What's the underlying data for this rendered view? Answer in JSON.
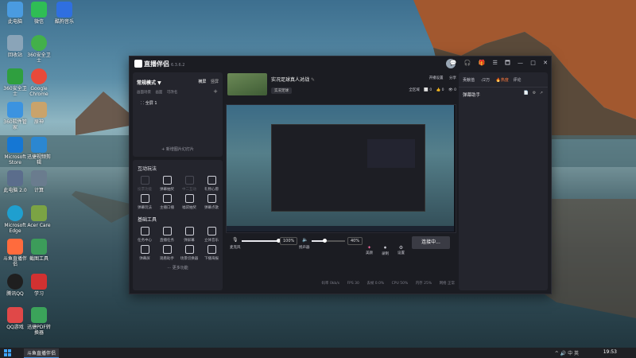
{
  "desktop": {
    "icons": [
      {
        "label": "此电脑",
        "color": "#4a9be0"
      },
      {
        "label": "微信",
        "color": "#2fbd55"
      },
      {
        "label": "酷狗音乐",
        "color": "#2f6fe0"
      },
      {
        "label": "回收站",
        "color": "#8aa4b8"
      },
      {
        "label": "360安全卫士",
        "color": "#43b04a"
      },
      {
        "label": "360安全卫士",
        "color": "#2f9f3f"
      },
      {
        "label": "Google Chrome",
        "color": "#e84a3a"
      },
      {
        "label": "360软件管家",
        "color": "#3b93e0"
      },
      {
        "label": "原神",
        "color": "#c9a36b"
      },
      {
        "label": "Microsoft Store",
        "color": "#1577d4"
      },
      {
        "label": "迅捷视频剪辑",
        "color": "#2b87d1"
      },
      {
        "label": "此电脑 2.0",
        "color": "#5b6d8c"
      },
      {
        "label": "计算",
        "color": "#6a7c8e"
      },
      {
        "label": "Microsoft Edge",
        "color": "#1f9fcf"
      },
      {
        "label": "Acer Care",
        "color": "#7ba344"
      },
      {
        "label": "斗鱼直播伴侣",
        "color": "#ff6b3d"
      },
      {
        "label": "截图工具",
        "color": "#3c9c5a"
      },
      {
        "label": "腾讯QQ",
        "color": "#1f1f1f"
      },
      {
        "label": "学习",
        "color": "#d13131"
      },
      {
        "label": "QQ游戏",
        "color": "#e04848"
      },
      {
        "label": "迅捷PDF转换器",
        "color": "#3ba35a"
      }
    ]
  },
  "app": {
    "name": "直播伴侣",
    "version": "6.3.6.2",
    "window_controls": [
      "💬",
      "🎧",
      "🎁",
      "☰",
      "🗖",
      "—",
      "□",
      "✕"
    ],
    "left": {
      "mode_label": "常规模式 ▼",
      "mode_tabs": [
        "横屏",
        "竖屏"
      ],
      "sub_tabs": [
        "画面场景",
        "画面",
        "可改名"
      ],
      "add_icon": "+",
      "scene_item": "⸬  全屏 1",
      "add_scene_button": "+ 新增图片幻灯片",
      "interactive_title": "互动玩法",
      "interactive_tools": [
        {
          "label": "投票功能",
          "enabled": false
        },
        {
          "label": "弹幕抽奖",
          "enabled": true
        },
        {
          "label": "中二互动",
          "enabled": false
        },
        {
          "label": "礼物心愿",
          "enabled": true
        },
        {
          "label": "弹幕玩法",
          "enabled": true
        },
        {
          "label": "主播口播",
          "enabled": true
        },
        {
          "label": "福袋抽奖",
          "enabled": true
        },
        {
          "label": "弹幕点歌",
          "enabled": true
        }
      ],
      "basic_title": "基础工具",
      "basic_tools": [
        {
          "label": "任务中心",
          "enabled": true
        },
        {
          "label": "直播任务",
          "enabled": true
        },
        {
          "label": "弹屏幕",
          "enabled": true
        },
        {
          "label": "立体音乐",
          "enabled": true
        },
        {
          "label": "弹幕屏",
          "enabled": true
        },
        {
          "label": "观看助手",
          "enabled": true
        },
        {
          "label": "场景切换器",
          "enabled": true
        },
        {
          "label": "下播海报",
          "enabled": true
        }
      ],
      "more_label": "更多功能",
      "more_icon": "⋯"
    },
    "center": {
      "stream_title": "实况足球真人对战",
      "edit_icon": "✎",
      "category_tag": "实况足球",
      "room_status": "开播设置",
      "share_label": "分享",
      "section_fullscreen": "全区域",
      "counters": [
        "⬜ 0",
        "👍 0",
        "👁 0"
      ],
      "mic_label": "麦克风",
      "mic_percent": "100%",
      "mic_level": 1.0,
      "speaker_label": "扬声器",
      "speaker_percent": "40%",
      "speaker_level": 0.4,
      "tools": [
        "美颜",
        "录制",
        "设置"
      ],
      "connect_button": "连接中...",
      "status_bar": [
        "码率 0kb/s",
        "FPS 30",
        "丢帧 0.0%",
        "CPU 50%",
        "内存 25%",
        "网络 正常"
      ]
    },
    "right": {
      "tabs": [
        "贡献值",
        "·/2万",
        "热度",
        "评论"
      ],
      "hot_label": "热度",
      "assistant_title": "弹幕助手",
      "assistant_icons": [
        "📄",
        "⚙",
        "↗"
      ]
    }
  },
  "taskbar": {
    "app_button": "斗鱼直播伴侣",
    "tray": "^ 🔊 中 英",
    "time": "19:53"
  }
}
